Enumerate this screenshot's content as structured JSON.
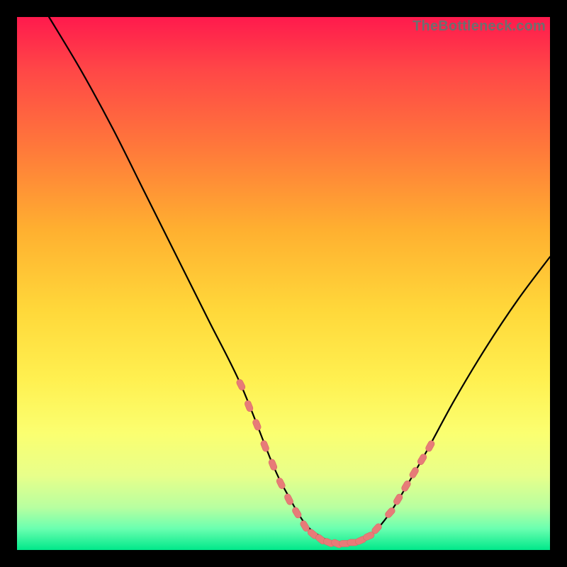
{
  "watermark": "TheBottleneck.com",
  "colors": {
    "frame": "#000000",
    "curve": "#000000",
    "marker_fill": "#e77b78",
    "marker_stroke": "#d86a67"
  },
  "chart_data": {
    "type": "line",
    "title": "",
    "xlabel": "",
    "ylabel": "",
    "xlim": [
      0,
      100
    ],
    "ylim": [
      0,
      100
    ],
    "series": [
      {
        "name": "curve",
        "x": [
          6,
          12,
          18,
          24,
          30,
          36,
          42,
          48,
          51,
          54,
          57,
          60,
          63,
          66,
          70,
          76,
          82,
          88,
          94,
          100
        ],
        "y": [
          100,
          90,
          79,
          67,
          55,
          43,
          31,
          16,
          10,
          5,
          2.5,
          1.2,
          1.2,
          2.5,
          7,
          17,
          28,
          38,
          47,
          55
        ]
      }
    ],
    "markers": [
      {
        "x": 42.0,
        "y": 31.0
      },
      {
        "x": 43.5,
        "y": 27.0
      },
      {
        "x": 45.0,
        "y": 23.5
      },
      {
        "x": 46.5,
        "y": 19.5
      },
      {
        "x": 48.0,
        "y": 16.0
      },
      {
        "x": 49.5,
        "y": 12.5
      },
      {
        "x": 51.0,
        "y": 9.5
      },
      {
        "x": 52.5,
        "y": 7.0
      },
      {
        "x": 54.0,
        "y": 4.5
      },
      {
        "x": 55.5,
        "y": 3.0
      },
      {
        "x": 57.0,
        "y": 2.0
      },
      {
        "x": 58.5,
        "y": 1.4
      },
      {
        "x": 60.0,
        "y": 1.2
      },
      {
        "x": 61.5,
        "y": 1.2
      },
      {
        "x": 63.0,
        "y": 1.4
      },
      {
        "x": 64.5,
        "y": 1.8
      },
      {
        "x": 66.0,
        "y": 2.6
      },
      {
        "x": 67.5,
        "y": 4.0
      },
      {
        "x": 70.0,
        "y": 7.0
      },
      {
        "x": 71.5,
        "y": 9.5
      },
      {
        "x": 73.0,
        "y": 12.0
      },
      {
        "x": 74.5,
        "y": 14.5
      },
      {
        "x": 76.0,
        "y": 17.0
      },
      {
        "x": 77.5,
        "y": 19.5
      }
    ]
  }
}
